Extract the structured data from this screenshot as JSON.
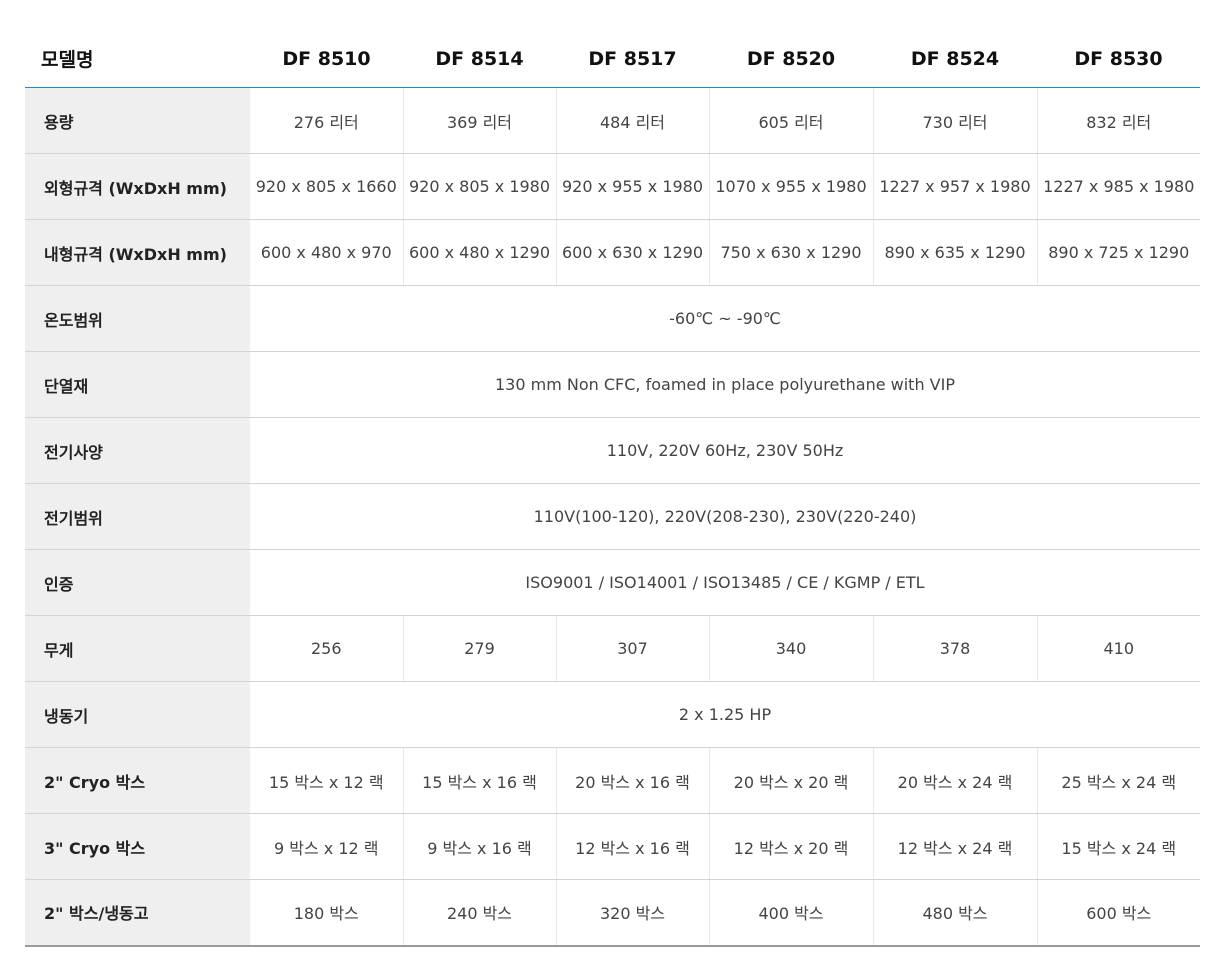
{
  "table": {
    "header_label": "모델명",
    "models": [
      "DF 8510",
      "DF 8514",
      "DF 8517",
      "DF 8520",
      "DF 8524",
      "DF 8530"
    ],
    "rows": {
      "capacity": {
        "label": "용량",
        "values": [
          "276 리터",
          "369 리터",
          "484 리터",
          "605 리터",
          "730 리터",
          "832 리터"
        ]
      },
      "exterior": {
        "label": "외형규격 (WxDxH mm)",
        "values": [
          "920 x 805 x 1660",
          "920 x 805 x 1980",
          "920 x 955 x 1980",
          "1070 x 955 x 1980",
          "1227 x 957 x 1980",
          "1227 x 985 x 1980"
        ]
      },
      "interior": {
        "label": "내형규격 (WxDxH mm)",
        "values": [
          "600 x 480 x 970",
          "600 x 480 x 1290",
          "600 x 630 x 1290",
          "750 x 630 x 1290",
          "890 x 635 x 1290",
          "890 x 725 x 1290"
        ]
      },
      "temp_range": {
        "label": "온도범위",
        "value": "-60℃ ~ -90℃"
      },
      "insulation": {
        "label": "단열재",
        "value": "130 mm Non CFC, foamed in place polyurethane with VIP"
      },
      "electrical_spec": {
        "label": "전기사양",
        "value": "110V, 220V 60Hz, 230V 50Hz"
      },
      "electrical_range": {
        "label": "전기범위",
        "value": "110V(100-120), 220V(208-230), 230V(220-240)"
      },
      "certification": {
        "label": "인증",
        "value": "ISO9001 / ISO14001 / ISO13485 / CE / KGMP / ETL"
      },
      "weight": {
        "label": "무게",
        "values": [
          "256",
          "279",
          "307",
          "340",
          "378",
          "410"
        ]
      },
      "refrigeration": {
        "label": "냉동기",
        "value": "2 x 1.25 HP"
      },
      "cryo2": {
        "label": "2\" Cryo 박스",
        "values": [
          "15 박스 x 12 랙",
          "15 박스 x 16 랙",
          "20 박스 x 16 랙",
          "20 박스 x 20 랙",
          "20 박스 x 24 랙",
          "25 박스 x 24 랙"
        ]
      },
      "cryo3": {
        "label": "3\" Cryo 박스",
        "values": [
          "9 박스 x 12 랙",
          "9 박스 x 16 랙",
          "12 박스 x 16 랙",
          "12 박스 x 20 랙",
          "12 박스 x 24 랙",
          "15 박스 x 24 랙"
        ]
      },
      "boxes_per_freezer": {
        "label": "2\" 박스/냉동고",
        "values": [
          "180 박스",
          "240 박스",
          "320 박스",
          "400 박스",
          "480 박스",
          "600 박스"
        ]
      }
    }
  }
}
